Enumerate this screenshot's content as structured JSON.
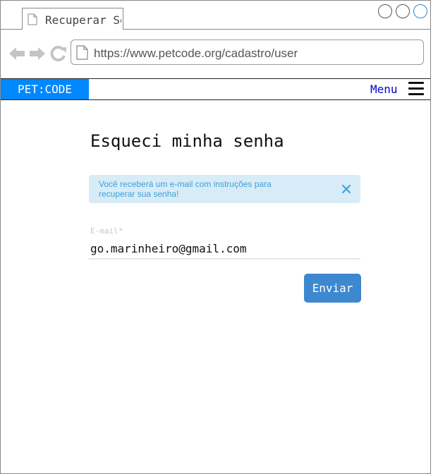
{
  "browser": {
    "tab_title": "Recuperar Senha",
    "url": "https://www.petcode.org/cadastro/user"
  },
  "navbar": {
    "brand": "PET:CODE",
    "menu_label": "Menu",
    "brand_color": "#0088ff",
    "menu_color": "#0000cc"
  },
  "page": {
    "title": "Esqueci minha senha",
    "alert_text": "Você receberá um e-mail com instruções para recuperar sua senha!",
    "alert_bg": "#d8ecf8",
    "alert_text_color": "#3aa0d6",
    "email_label": "E-mail*",
    "email_value": "go.marinheiro@gmail.com",
    "submit_label": "Enviar",
    "submit_color": "#3d88cf"
  },
  "icons": {
    "tab": "document-icon",
    "back": "back-arrow-icon",
    "forward": "forward-arrow-icon",
    "reload": "reload-icon",
    "url": "document-icon",
    "menu": "hamburger-icon",
    "close": "close-icon"
  }
}
